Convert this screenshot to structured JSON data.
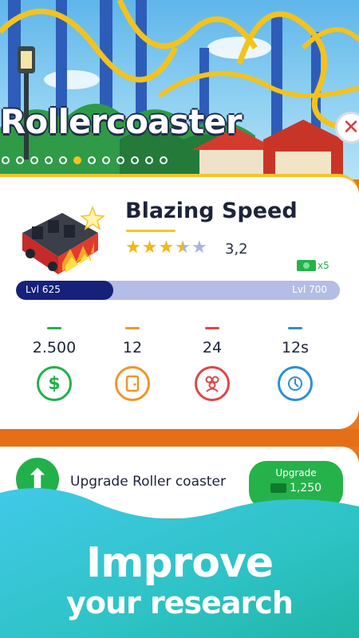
{
  "header": {
    "title": "Rollercoaster",
    "close_icon": "close-icon",
    "page_dots": {
      "count": 12,
      "active_index": 5
    }
  },
  "ride": {
    "name": "Blazing Speed",
    "image_icon": "train-car-icon",
    "rating_text": "3,2",
    "rating_value": 3.2,
    "stars_max": 5,
    "cash_multiplier": "x5",
    "level": {
      "current_label": "Lvl 625",
      "next_label": "Lvl 700",
      "progress": 0.3
    }
  },
  "stats": [
    {
      "value": "2.500",
      "icon": "dollar-icon",
      "color": "#22b04a"
    },
    {
      "value": "12",
      "icon": "door-icon",
      "color": "#f0962a"
    },
    {
      "value": "24",
      "icon": "people-icon",
      "color": "#e24545"
    },
    {
      "value": "12s",
      "icon": "clock-icon",
      "color": "#2d8fd8"
    }
  ],
  "upgrade": {
    "label": "Upgrade Roller coaster",
    "button_label": "Upgrade",
    "price": "1,250"
  },
  "promo": {
    "line1": "Improve",
    "line2": "your research"
  },
  "colors": {
    "accent_yellow": "#f3c529",
    "level_fill": "#16217a",
    "level_track": "#b3bde5",
    "green": "#25b24a",
    "orange_bg": "#e8781e",
    "teal": "#2ec3c6"
  }
}
